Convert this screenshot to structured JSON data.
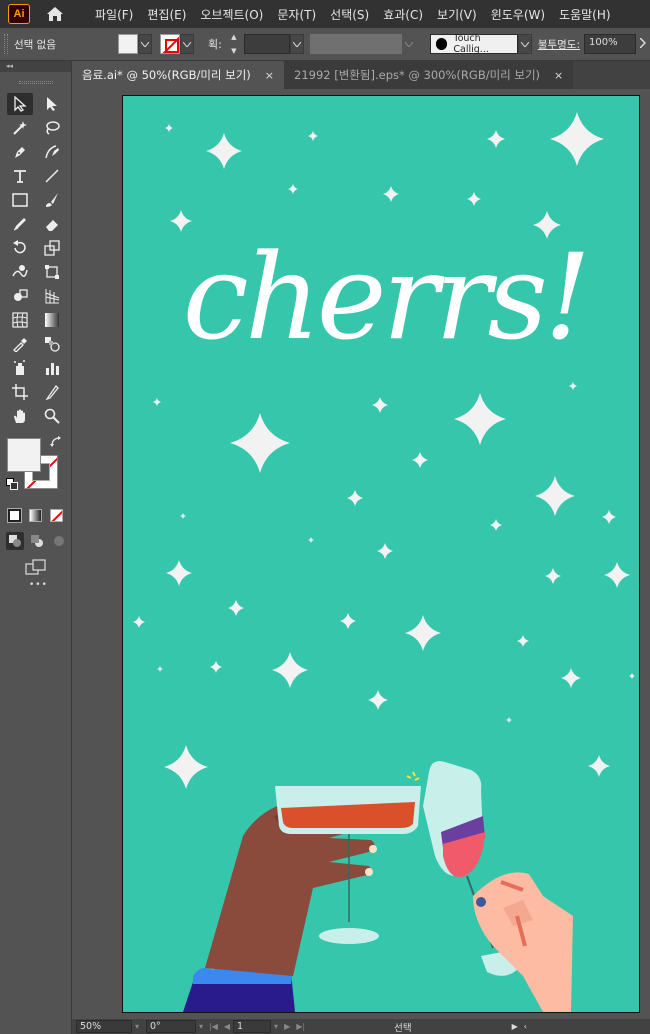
{
  "app": {
    "logo": "Ai"
  },
  "menu": [
    "파일(F)",
    "편집(E)",
    "오브젝트(O)",
    "문자(T)",
    "선택(S)",
    "효과(C)",
    "보기(V)",
    "윈도우(W)",
    "도움말(H)"
  ],
  "control_bar": {
    "selection_status": "선택 없음",
    "stroke_label": "획:",
    "stroke_value": "",
    "brush_name": "Touch Callig...",
    "opacity_label": "불투명도:",
    "opacity_value": "100%"
  },
  "toolbar": {
    "collapse_label": "◂◂",
    "more_label": "•••"
  },
  "tabs": [
    {
      "label": "음료.ai* @ 50%(RGB/미리 보기)",
      "close": "×"
    },
    {
      "label": "21992 [변환됨].eps* @ 300%(RGB/미리 보기)",
      "close": "×"
    }
  ],
  "artwork": {
    "text": "cherrs!"
  },
  "status_bar": {
    "zoom": "50%",
    "rotation": "0°",
    "artboard_number": "1",
    "tool_status": "선택"
  },
  "colors": {
    "background": "#36c6ac",
    "sparkle": "#f2f2f2",
    "lettering": "#ffffff",
    "dark_skin": "#8a4a3c",
    "light_skin": "#fdbba3",
    "sleeve": "#2a1b8c",
    "cuff": "#3a88f0",
    "glass": "#c8efe9",
    "orange_drink": "#d9502a",
    "red_wine": "#f05a6a",
    "purple_wine": "#6b3fa0",
    "accent": "#ff9a00"
  }
}
